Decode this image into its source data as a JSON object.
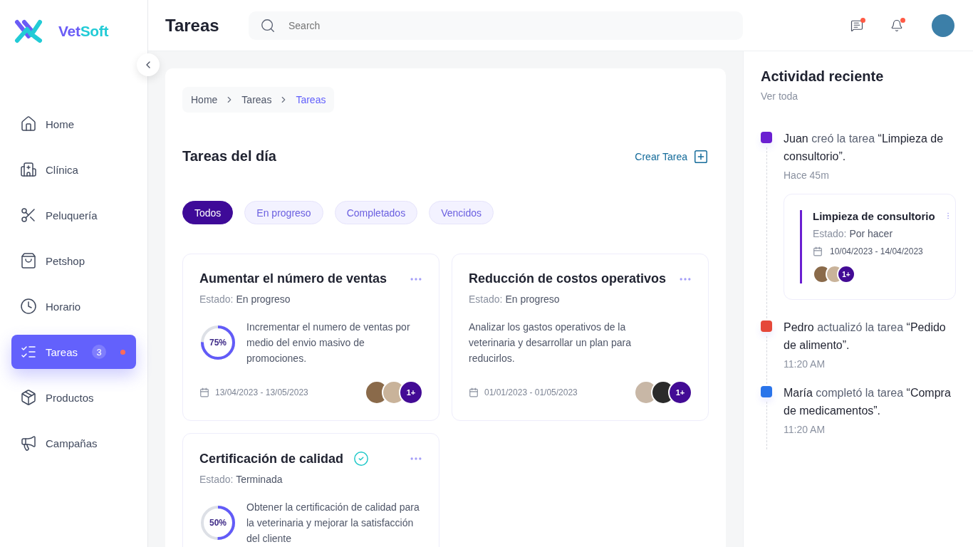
{
  "brand": {
    "first": "Vet",
    "second": "Soft"
  },
  "sidebar": {
    "items": [
      {
        "label": "Home",
        "selected": false,
        "alert": false
      },
      {
        "label": "Clínica",
        "selected": false,
        "alert": false
      },
      {
        "label": "Peluquería",
        "selected": false,
        "alert": false
      },
      {
        "label": "Petshop",
        "selected": false,
        "alert": false
      },
      {
        "label": "Horario",
        "selected": false,
        "alert": false
      },
      {
        "label": "Tareas",
        "selected": true,
        "badge": "3",
        "alert": true
      },
      {
        "label": "Productos",
        "selected": false,
        "alert": false
      },
      {
        "label": "Campañas",
        "selected": false,
        "alert": false
      }
    ]
  },
  "header": {
    "title": "Tareas",
    "search": {
      "placeholder": "Search"
    },
    "messages": {
      "unread": true
    },
    "notifications": {
      "unread": true
    }
  },
  "breadcrumb": [
    {
      "label": "Home",
      "selected": false
    },
    {
      "label": "Tareas",
      "selected": false
    },
    {
      "label": "Tareas",
      "selected": true
    }
  ],
  "section": {
    "title": "Tareas del día",
    "create_button": "Crear Tarea"
  },
  "filters": [
    {
      "label": "Todos",
      "selected": true
    },
    {
      "label": "En progreso",
      "selected": false
    },
    {
      "label": "Completados",
      "selected": false
    },
    {
      "label": "Vencidos",
      "selected": false
    }
  ],
  "tasks": [
    {
      "title": "Aumentar el número de ventas",
      "completed": false,
      "status_label": "Estado:",
      "status": "En progreso",
      "progress": {
        "level": 0.75,
        "reading": "75%"
      },
      "description": "Incrementar el numero de ventas por medio del envio masivo de promociones.",
      "dates": "13/04/2023 - 13/05/2023",
      "more": "1+"
    },
    {
      "title": "Reducción de costos operativos",
      "completed": false,
      "status_label": "Estado:",
      "status": "En progreso",
      "description": "Analizar los gastos operativos de la veterinaria y desarrollar un plan para reducirlos.",
      "dates": "01/01/2023 - 01/05/2023",
      "more": "1+"
    },
    {
      "title": "Certificación de calidad",
      "completed": true,
      "status_label": "Estado:",
      "status": "Terminada",
      "progress": {
        "level": 0.5,
        "reading": "50%"
      },
      "description": "Obtener la certificación de calidad para la veterinaria y mejorar la satisfacción del cliente"
    }
  ],
  "activity": {
    "title": "Actividad reciente",
    "link": "Ver toda",
    "entries": [
      {
        "color": "#6a1fd1",
        "actor": "Juan",
        "action": "creó la tarea",
        "subject": "“Limpieza de consultorio”.",
        "time": "Hace 45m",
        "card": {
          "title": "Limpieza de consultorio",
          "status_label": "Estado:",
          "status": "Por hacer",
          "dates": "10/04/2023 - 14/04/2023",
          "more": "1+"
        }
      },
      {
        "color": "#e5483a",
        "actor": "Pedro",
        "action": "actualizó la tarea",
        "subject": "“Pedido de alimento”.",
        "time": "11:20 AM"
      },
      {
        "color": "#2a74ea",
        "actor": "María",
        "action": "completó la tarea",
        "subject": "“Compra de medicamentos”.",
        "time": "11:20 AM"
      }
    ]
  }
}
